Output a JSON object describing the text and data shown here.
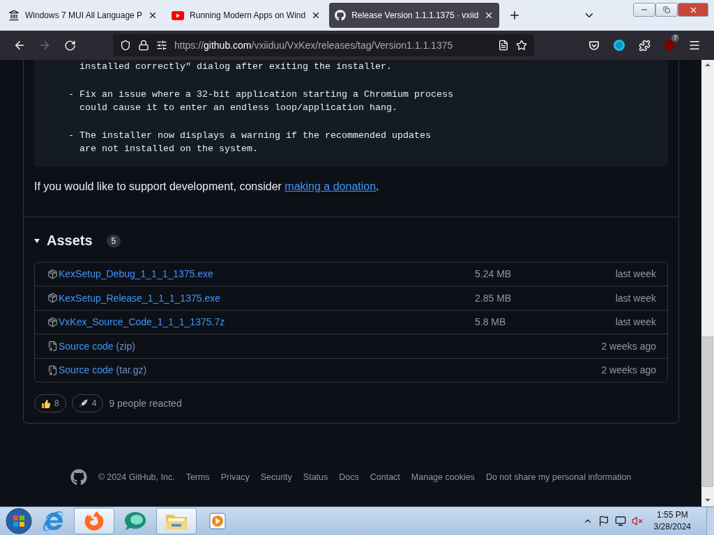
{
  "browser": {
    "tabs": [
      {
        "kind": "wiki",
        "title": "Windows 7 MUI All Language P",
        "selected": false
      },
      {
        "kind": "video",
        "title": "Running Modern Apps on Wind",
        "selected": false
      },
      {
        "kind": "code",
        "title": "Release Version 1.1.1.1375 · vxiid",
        "selected": true
      }
    ],
    "nav": {
      "back_disabled": false,
      "forward_disabled": true
    },
    "url": {
      "scheme": "https://",
      "host": "github.com",
      "path": "/vxiiduu/VxKex/releases/tag/Version1.1.1.1375"
    },
    "extension_badge": "7"
  },
  "release": {
    "notes": [
      "  installed correctly\" dialog after exiting the installer.",
      "- Fix an issue where a 32-bit application starting a Chromium process\n  could cause it to enter an endless loop/application hang.",
      "- The installer now displays a warning if the recommended updates\n  are not installed on the system."
    ],
    "support": {
      "text": "If you would like to support development, consider ",
      "link": "making a donation",
      "end": "."
    },
    "assets": {
      "title": "Assets",
      "count": "5",
      "expanded": true,
      "items": [
        {
          "kind": "package",
          "name": "KexSetup_Debug_1_1_1_1375.exe",
          "size": "5.24 MB",
          "date": "last week"
        },
        {
          "kind": "package",
          "name": "KexSetup_Release_1_1_1_1375.exe",
          "size": "2.85 MB",
          "date": "last week"
        },
        {
          "kind": "package",
          "name": "VxKex_Source_Code_1_1_1_1375.7z",
          "size": "5.8 MB",
          "date": "last week"
        },
        {
          "kind": "source",
          "name": "Source code",
          "suffix": "(zip)",
          "date": "2 weeks ago"
        },
        {
          "kind": "source",
          "name": "Source code",
          "suffix": "(tar.gz)",
          "date": "2 weeks ago"
        }
      ]
    },
    "reactions": [
      {
        "kind": "thumbs",
        "count": "8"
      },
      {
        "kind": "rocket",
        "count": "4"
      }
    ],
    "reaction_summary": "9 people reacted"
  },
  "footer": {
    "copyright": "© 2024 GitHub, Inc.",
    "links": [
      "Terms",
      "Privacy",
      "Security",
      "Status",
      "Docs",
      "Contact",
      "Manage cookies",
      "Do not share my personal information"
    ]
  },
  "taskbar": {
    "apps": [
      {
        "kind": "ie",
        "active": false
      },
      {
        "kind": "firefox",
        "active": true
      },
      {
        "kind": "bubble",
        "active": false
      },
      {
        "kind": "folder",
        "active": true
      },
      {
        "kind": "media",
        "active": false
      }
    ],
    "time": "1:55 PM",
    "date": "3/28/2024"
  }
}
